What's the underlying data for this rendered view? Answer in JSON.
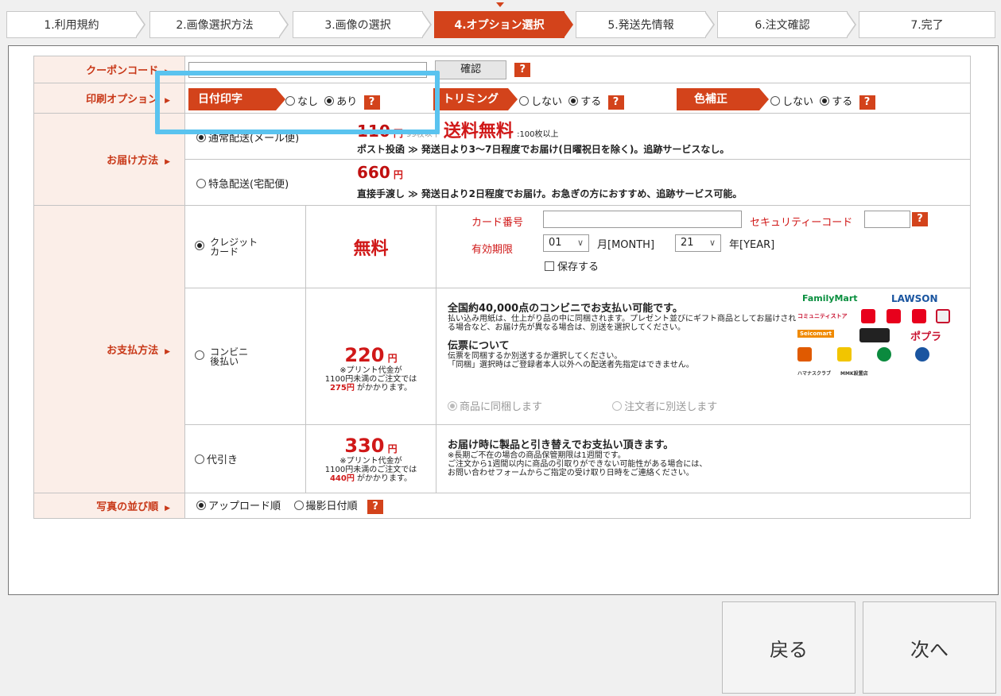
{
  "steps": [
    {
      "label": "1.利用規約"
    },
    {
      "label": "2.画像選択方法"
    },
    {
      "label": "3.画像の選択"
    },
    {
      "label": "4.オプション選択"
    },
    {
      "label": "5.発送先情報"
    },
    {
      "label": "6.注文確認"
    },
    {
      "label": "7.完了"
    }
  ],
  "coupon": {
    "label": "クーポンコード",
    "value": "",
    "confirm": "確認",
    "help": "?"
  },
  "print_options": {
    "label": "印刷オプション",
    "date": {
      "tag": "日付印字",
      "no": "なし",
      "yes": "あり",
      "selected": "yes"
    },
    "trim": {
      "tag": "トリミング",
      "no": "しない",
      "yes": "する",
      "selected": "yes"
    },
    "color": {
      "tag": "色補正",
      "no": "しない",
      "yes": "する",
      "selected": "yes"
    }
  },
  "delivery": {
    "label": "お届け方法",
    "mail": {
      "name": "通常配送(メール便)",
      "price": "110",
      "unit": "円",
      "cond1": "99枚以下",
      "free": "送料無料",
      "cond2": ":100枚以上",
      "desc": "ポスト投函 ≫ 発送日より3～7日程度でお届け(日曜祝日を除く)。追跡サービスなし。"
    },
    "express": {
      "name": "特急配送(宅配便)",
      "price": "660",
      "unit": "円",
      "desc": "直接手渡し ≫ 発送日より2日程度でお届け。お急ぎの方におすすめ、追跡サービス可能。"
    }
  },
  "payment": {
    "label": "お支払方法",
    "card": {
      "name1": "クレジット",
      "name2": "カード",
      "fee": "無料",
      "card_no_label": "カード番号",
      "security_label": "セキュリティーコード",
      "expiry_label": "有効期限",
      "month": "01",
      "month_unit": "月[MONTH]",
      "year": "21",
      "year_unit": "年[YEAR]",
      "save": "保存する"
    },
    "convenience": {
      "name1": "コンビニ",
      "name2": "後払い",
      "fee": "220",
      "unit": "円",
      "note1": "※プリント代金が",
      "note2": "1100円未満のご注文では",
      "note3_red": "275円",
      "note3": "がかかります。",
      "head": "全国約40,000点のコンビニでお支払い可能です。",
      "body": "払い込み用紙は、仕上がり品の中に同梱されます。プレゼント並びにギフト商品としてお届けされる場合など、お届け先が異なる場合は、別送を選択してください。",
      "slip_head": "伝票について",
      "slip_body1": "伝票を同梱するか別送するか選択してください。",
      "slip_body2": "「同梱」選択時はご登録者本人以外への配送者先指定はできません。",
      "opt_with": "商品に同梱します",
      "opt_sep": "注文者に別送します",
      "logos": [
        "FamilyMart",
        "LAWSON",
        "コミュニティストア",
        "Seicomart",
        "ポプラ",
        "ハマナスクラブ",
        "MMK設置店"
      ]
    },
    "cod": {
      "name": "代引き",
      "fee": "330",
      "unit": "円",
      "note1": "※プリント代金が",
      "note2": "1100円未満のご注文では",
      "note3_red": "440円",
      "note3": "がかかります。",
      "head": "お届け時に製品と引き替えでお支払い頂きます。",
      "body1": "※長期ご不在の場合の商品保管期限は1週間です。",
      "body2": "ご注文から1週間以内に商品の引取りができない可能性がある場合には、",
      "body3": "お問い合わせフォームからご指定の受け取り日時をご連絡ください。"
    }
  },
  "sort": {
    "label": "写真の並び順",
    "upload": "アップロード順",
    "shot": "撮影日付順"
  },
  "nav": {
    "back": "戻る",
    "next": "次へ"
  },
  "colors": {
    "accent": "#d3431b",
    "highlight": "#5ac3ef"
  }
}
